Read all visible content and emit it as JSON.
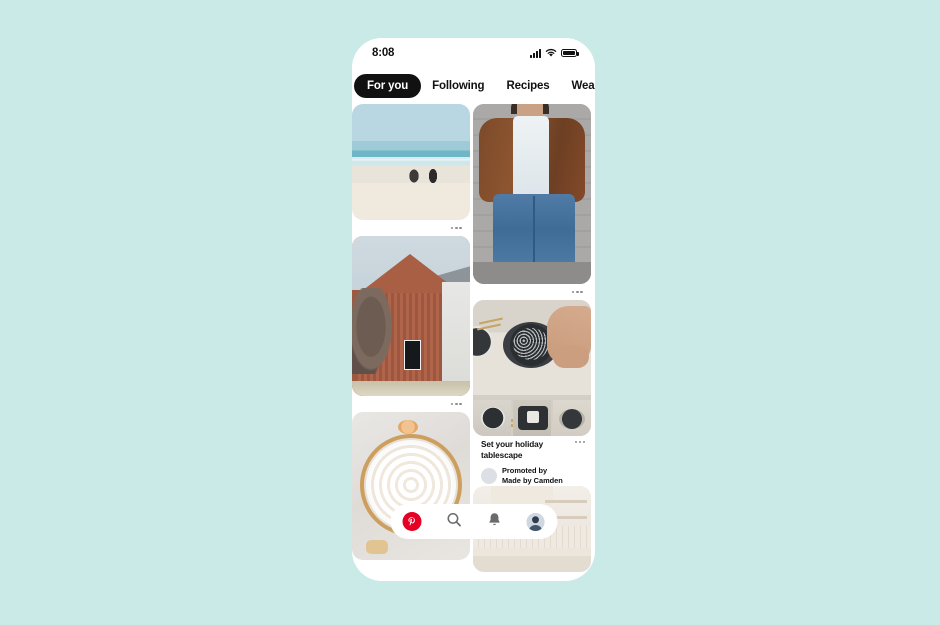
{
  "theme": {
    "page_background": "#c9eae7",
    "phone_background": "#ffffff",
    "accent_red": "#e60023",
    "tab_active_background": "#111111"
  },
  "status_bar": {
    "time": "8:08",
    "icons": [
      "signal-icon",
      "wifi-icon",
      "battery-icon"
    ]
  },
  "tabs": [
    {
      "label": "For you",
      "active": true
    },
    {
      "label": "Following",
      "active": false
    },
    {
      "label": "Recipes",
      "active": false
    },
    {
      "label": "Wear",
      "active": false
    }
  ],
  "feed": {
    "left_column": [
      {
        "name": "pin-beach",
        "description": "Two surfers walking on a white sand beach toward turquoise ocean",
        "has_overflow_menu": true
      },
      {
        "name": "pin-barn-house",
        "description": "Red-brown timber clad gabled barn house with dark window and bare tree",
        "has_overflow_menu": true
      },
      {
        "name": "pin-meringue-pie",
        "description": "Swirled meringue tart on marble with citrus slice",
        "has_overflow_menu": false
      }
    ],
    "right_column": [
      {
        "name": "pin-outfit",
        "description": "Woman in brown leather bomber jacket, white tank top and blue wide leg jeans",
        "has_overflow_menu": true
      },
      {
        "name": "pin-promoted-tablescape",
        "description": "Dark speckled dinner plates with gold cutlery on linen table runner",
        "has_overflow_menu": true
      },
      {
        "name": "pin-kitchen",
        "description": "Bright neutral kitchen with open shelving and tiled backsplash",
        "has_overflow_menu": false
      }
    ]
  },
  "promoted_pin": {
    "title": "Set your holiday tablescape",
    "promoted_label": "Promoted by",
    "advertiser": "Made by Camden",
    "avatar": "advertiser-avatar",
    "overflow_menu": "overflow-menu-icon"
  },
  "bottom_nav": [
    {
      "name": "home",
      "icon": "pinterest-logo-icon",
      "label": "Home"
    },
    {
      "name": "search",
      "icon": "search-icon",
      "label": "Search"
    },
    {
      "name": "notifications",
      "icon": "bell-icon",
      "label": "Notifications"
    },
    {
      "name": "profile",
      "icon": "avatar-icon",
      "label": "Profile"
    }
  ]
}
